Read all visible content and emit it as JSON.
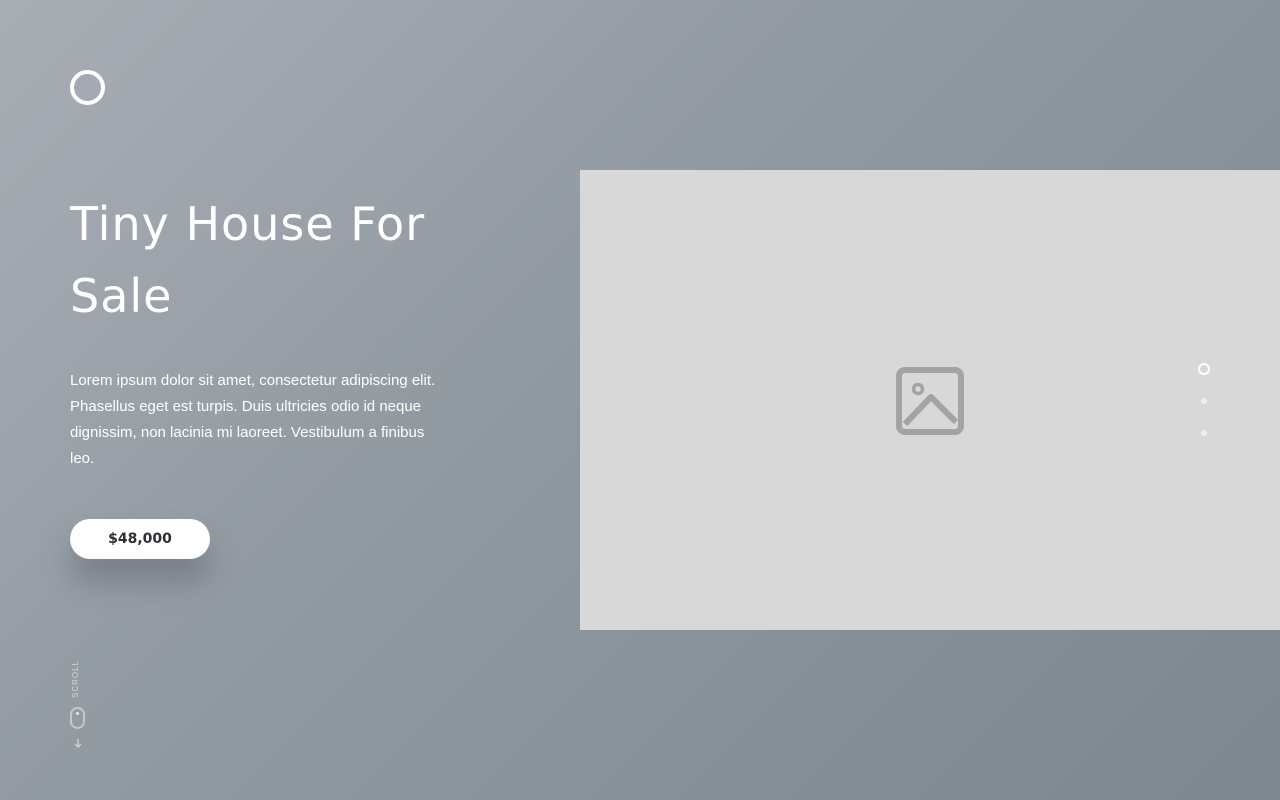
{
  "hero": {
    "title": "Tiny House For Sale",
    "description": "Lorem ipsum dolor sit amet, consectetur adipiscing elit. Phasellus eget est turpis. Duis ultricies odio id neque dignissim, non lacinia mi laoreet. Vestibulum a finibus leo.",
    "price_label": "$48,000"
  },
  "scroll": {
    "label": "SCROLL"
  },
  "media": {
    "icon": "image-placeholder-icon"
  },
  "pager": {
    "count": 3,
    "active_index": 0
  },
  "colors": {
    "background_start": "#a9aeb5",
    "background_end": "#7d8790",
    "panel": "#d8d8d8",
    "button_text": "#2b2f33"
  }
}
